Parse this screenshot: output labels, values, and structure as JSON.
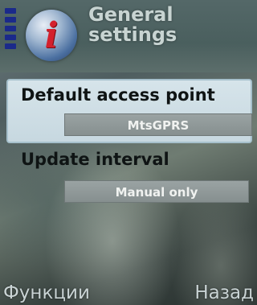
{
  "header": {
    "title_line1": "General",
    "title_line2": "settings",
    "icon": "info-globe-icon"
  },
  "settings": [
    {
      "label": "Default access point",
      "value": "MtsGPRS",
      "selected": true
    },
    {
      "label": "Update interval",
      "value": "Manual only",
      "selected": false
    }
  ],
  "softkeys": {
    "left": "Функции",
    "right": "Назад"
  },
  "colors": {
    "signal": "#1b2a8a",
    "badge": "#d4202c",
    "highlight": "#d6e4ea"
  }
}
